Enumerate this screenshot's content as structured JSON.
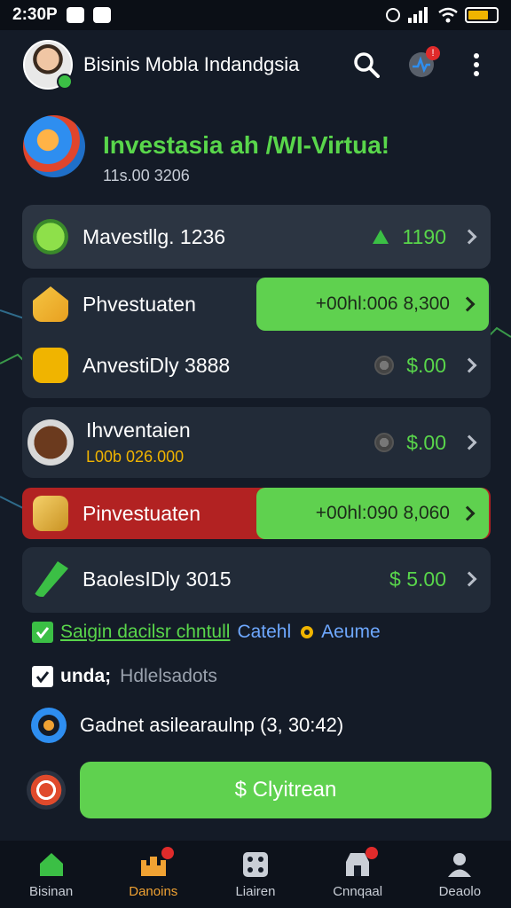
{
  "status_bar": {
    "time": "2:30P"
  },
  "header": {
    "title": "Bisinis Mobla Indandgsia"
  },
  "hero": {
    "title": "Investasia ah /WI-Virtua!",
    "subtitle": "11s.00 3206"
  },
  "rows": [
    {
      "label": "Mavestllg. 1236",
      "amount": "1190"
    },
    {
      "label": "Phvestuaten",
      "pill": "+00hl:006 8,300"
    },
    {
      "label": "AnvestiDly 3888",
      "amount": "$.00"
    },
    {
      "label": "Ihvventaien",
      "sublabel": "L00b 026.000",
      "amount": "$.00"
    },
    {
      "label": "Pinvestuaten",
      "pill": "+00hl:090 8,060"
    },
    {
      "label": "BaolesIDly 3015",
      "amount": "$ 5.00"
    }
  ],
  "checks": [
    {
      "text": "Saigin dacilsr chntull",
      "link": "Catehl",
      "extra": "Aeume"
    },
    {
      "text": "unda;",
      "extra": "Hdlelsadots"
    }
  ],
  "info_line": "Gadnet asilearaulnp (3, 30:42)",
  "cta": {
    "label": "$ Clyitrean"
  },
  "nav": [
    {
      "label": "Bisinan",
      "icon": "home-icon",
      "active": false
    },
    {
      "label": "Danoins",
      "icon": "castle-icon",
      "active": true
    },
    {
      "label": "Liairen",
      "icon": "dice-icon",
      "active": false
    },
    {
      "label": "Cnnqaal",
      "icon": "shop-icon",
      "active": false
    },
    {
      "label": "Deaolo",
      "icon": "user-icon",
      "active": false
    }
  ],
  "colors": {
    "accent_green": "#5fd14f",
    "text_green": "#59d64b",
    "danger_red": "#b22222",
    "card_bg": "#222b38",
    "page_bg": "#141b27"
  }
}
